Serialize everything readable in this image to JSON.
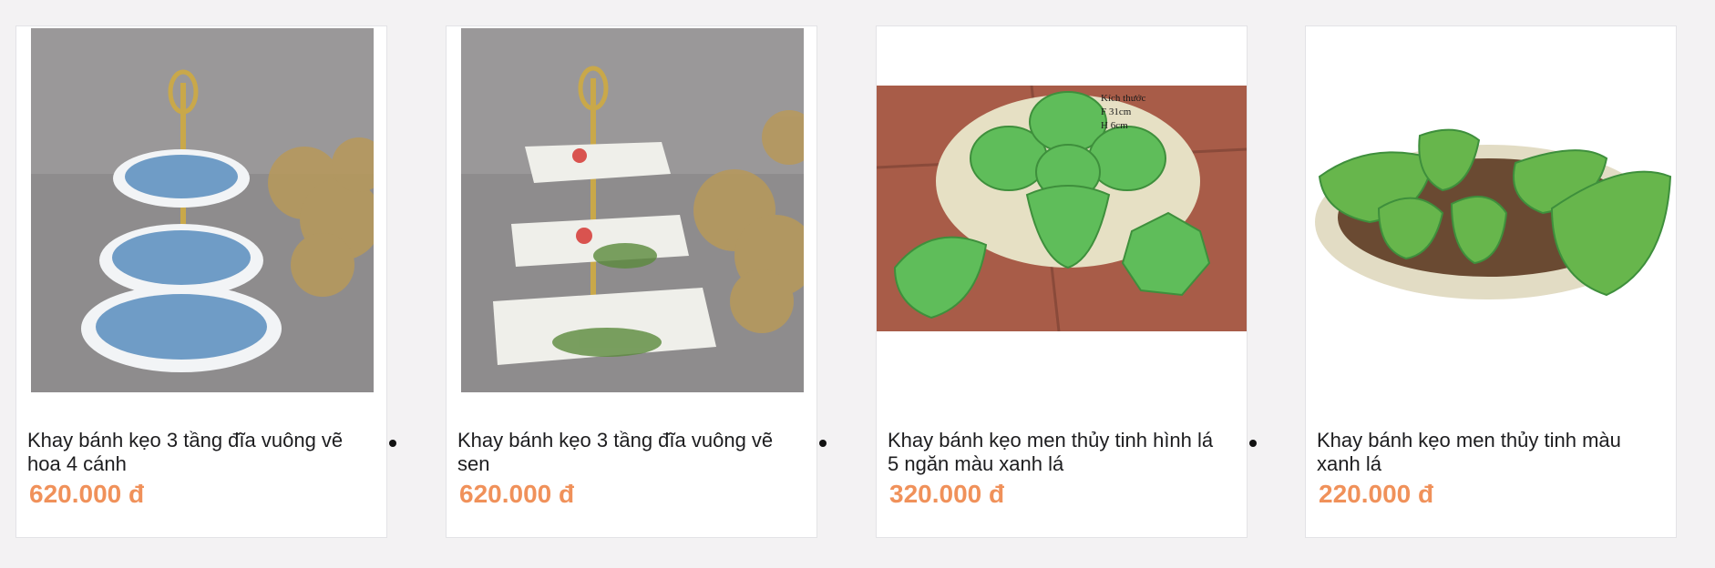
{
  "products": [
    {
      "title": "Khay bánh kẹo 3 tầng đĩa vuông vẽ hoa 4 cánh",
      "price": "620.000 đ",
      "image": "three-tier-blue-flower-tray"
    },
    {
      "title": "Khay bánh kẹo 3 tầng đĩa vuông vẽ sen",
      "price": "620.000 đ",
      "image": "three-tier-lotus-tray"
    },
    {
      "title": "Khay bánh kẹo men thủy tinh hình lá 5 ngăn màu xanh lá",
      "price": "320.000 đ",
      "image": "green-leaf-five-compartment-tray",
      "image_text": [
        "Kích thước",
        "F 31cm",
        "H 6cm"
      ]
    },
    {
      "title": "Khay bánh kẹo men thủy tinh màu xanh lá",
      "price": "220.000 đ",
      "image": "green-leaf-tray-basket"
    }
  ],
  "colors": {
    "price": "#f0915a",
    "background": "#f3f2f3",
    "card_border": "#e3e3e6"
  }
}
